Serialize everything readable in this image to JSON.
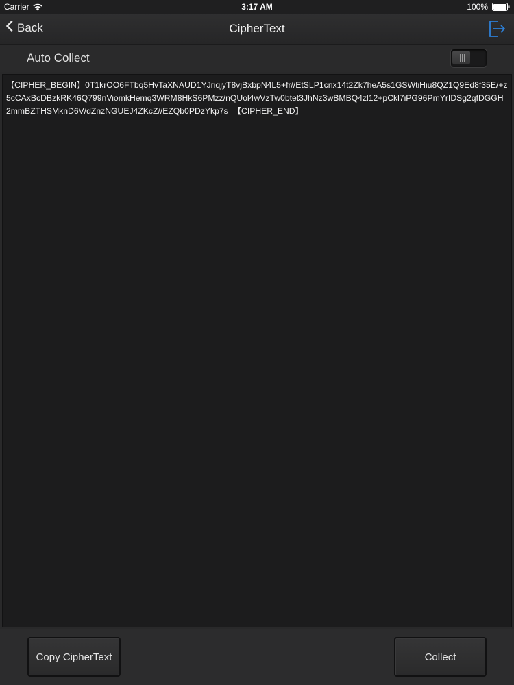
{
  "status_bar": {
    "carrier": "Carrier",
    "time": "3:17 AM",
    "battery": "100%"
  },
  "nav": {
    "back_label": "Back",
    "title": "CipherText",
    "accent_color": "#2d7fd6"
  },
  "auto_collect": {
    "label": "Auto Collect",
    "enabled": false
  },
  "cipher_text": "【CIPHER_BEGIN】0T1krOO6FTbq5HvTaXNAUD1YJriqjyT8vjBxbpN4L5+fr//EtSLP1cnx14t2Zk7heA5s1GSWtiHiu8QZ1Q9Ed8f35E/+z5cCAxBcDBzkRK46Q799nViomkHemq3WRM8HkS6PMzz/nQUol4wVzTw0btet3JhNz3wBMBQ4zl12+pCkl7iPG96PmYrIDSg2qfDGGH2mmBZTHSMknD6V/dZnzNGUEJ4ZKcZ//EZQb0PDzYkp7s=【CIPHER_END】",
  "buttons": {
    "copy_label": "Copy CipherText",
    "collect_label": "Collect"
  }
}
